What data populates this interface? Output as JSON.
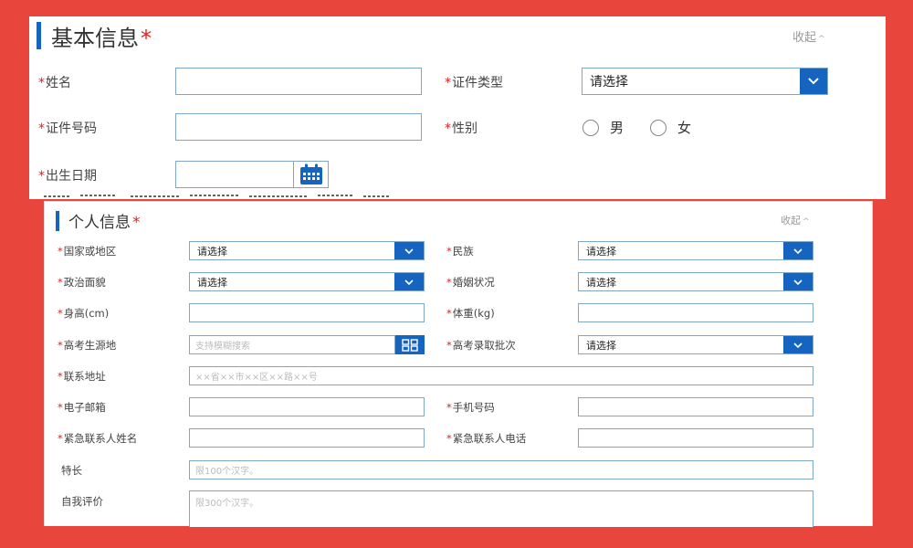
{
  "basic": {
    "title": "基本信息",
    "required_mark": "*",
    "collapse": "收起",
    "fields": {
      "name": "姓名",
      "id_type": "证件类型",
      "id_number": "证件号码",
      "gender": "性别",
      "birth_date": "出生日期"
    },
    "id_type_value": "请选择",
    "gender_options": [
      "男",
      "女"
    ]
  },
  "personal": {
    "title": "个人信息",
    "required_mark": "*",
    "collapse": "收起",
    "fields": {
      "region": "国家或地区",
      "ethnicity": "民族",
      "political": "政治面貌",
      "marital": "婚姻状况",
      "height": "身高(cm)",
      "weight": "体重(kg)",
      "exam_origin": "高考生源地",
      "admission_batch": "高考录取批次",
      "address": "联系地址",
      "email": "电子邮箱",
      "phone": "手机号码",
      "emergency_name": "紧急联系人姓名",
      "emergency_phone": "紧急联系人电话",
      "specialty": "特长",
      "self_eval": "自我评价"
    },
    "select_default": "请选择",
    "placeholders": {
      "exam_origin": "支持模糊搜索",
      "address": "××省××市××区××路××号",
      "specialty": "限100个汉字。",
      "self_eval": "限300个汉字。"
    }
  },
  "colors": {
    "background": "#e8463c",
    "accent": "#1565c0",
    "required": "#e02020"
  }
}
